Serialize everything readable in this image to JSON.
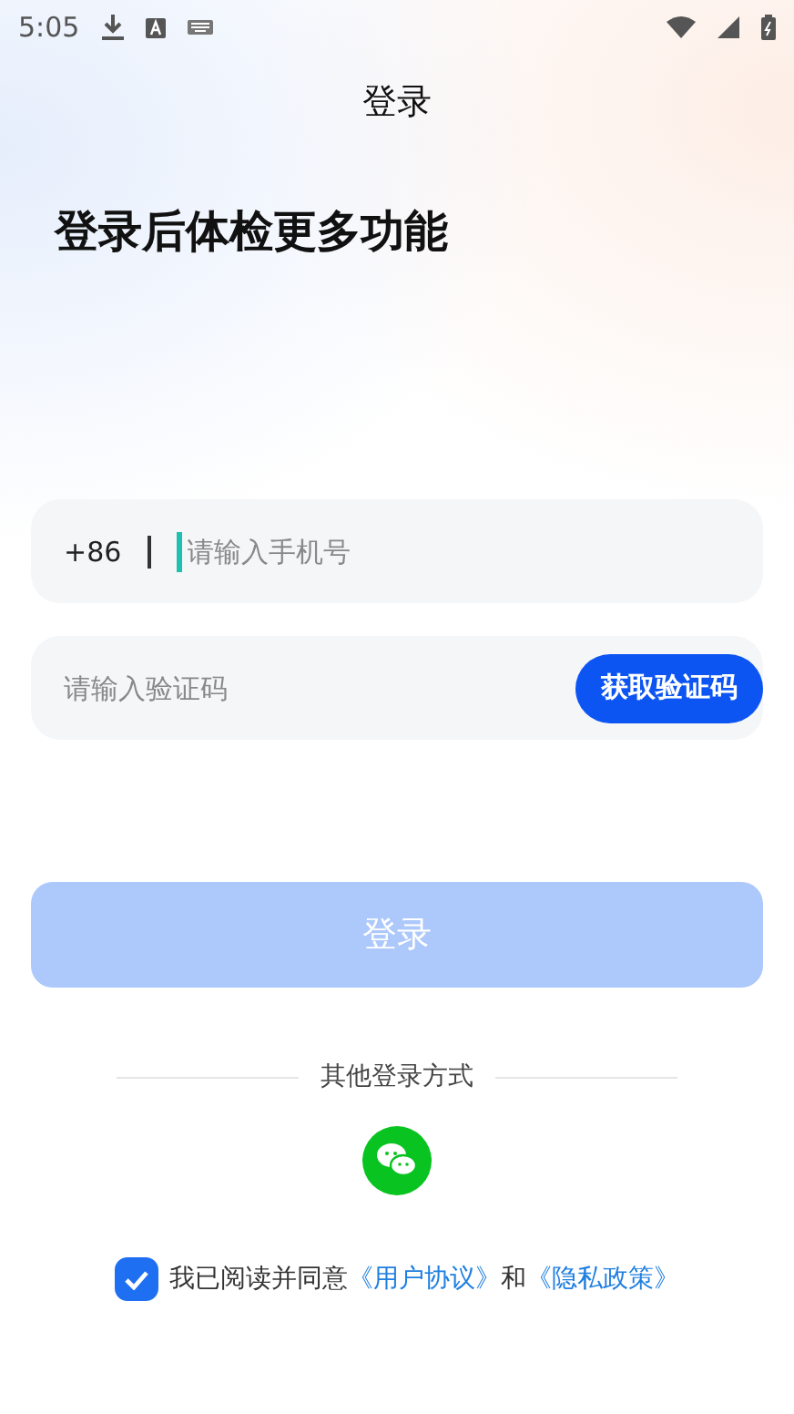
{
  "status_bar": {
    "time": "5:05"
  },
  "title": "登录",
  "headline": "登录后体检更多功能",
  "phone_field": {
    "prefix": "+86",
    "placeholder": "请输入手机号",
    "focused": true
  },
  "code_field": {
    "placeholder": "请输入验证码",
    "button": "获取验证码"
  },
  "login_button": {
    "label": "登录",
    "disabled": true
  },
  "other_methods": {
    "label": "其他登录方式"
  },
  "agreement": {
    "checked": true,
    "text": "我已阅读并同意",
    "links": [
      "《用户协议》",
      "《隐私政策》"
    ],
    "joiner": "和"
  }
}
